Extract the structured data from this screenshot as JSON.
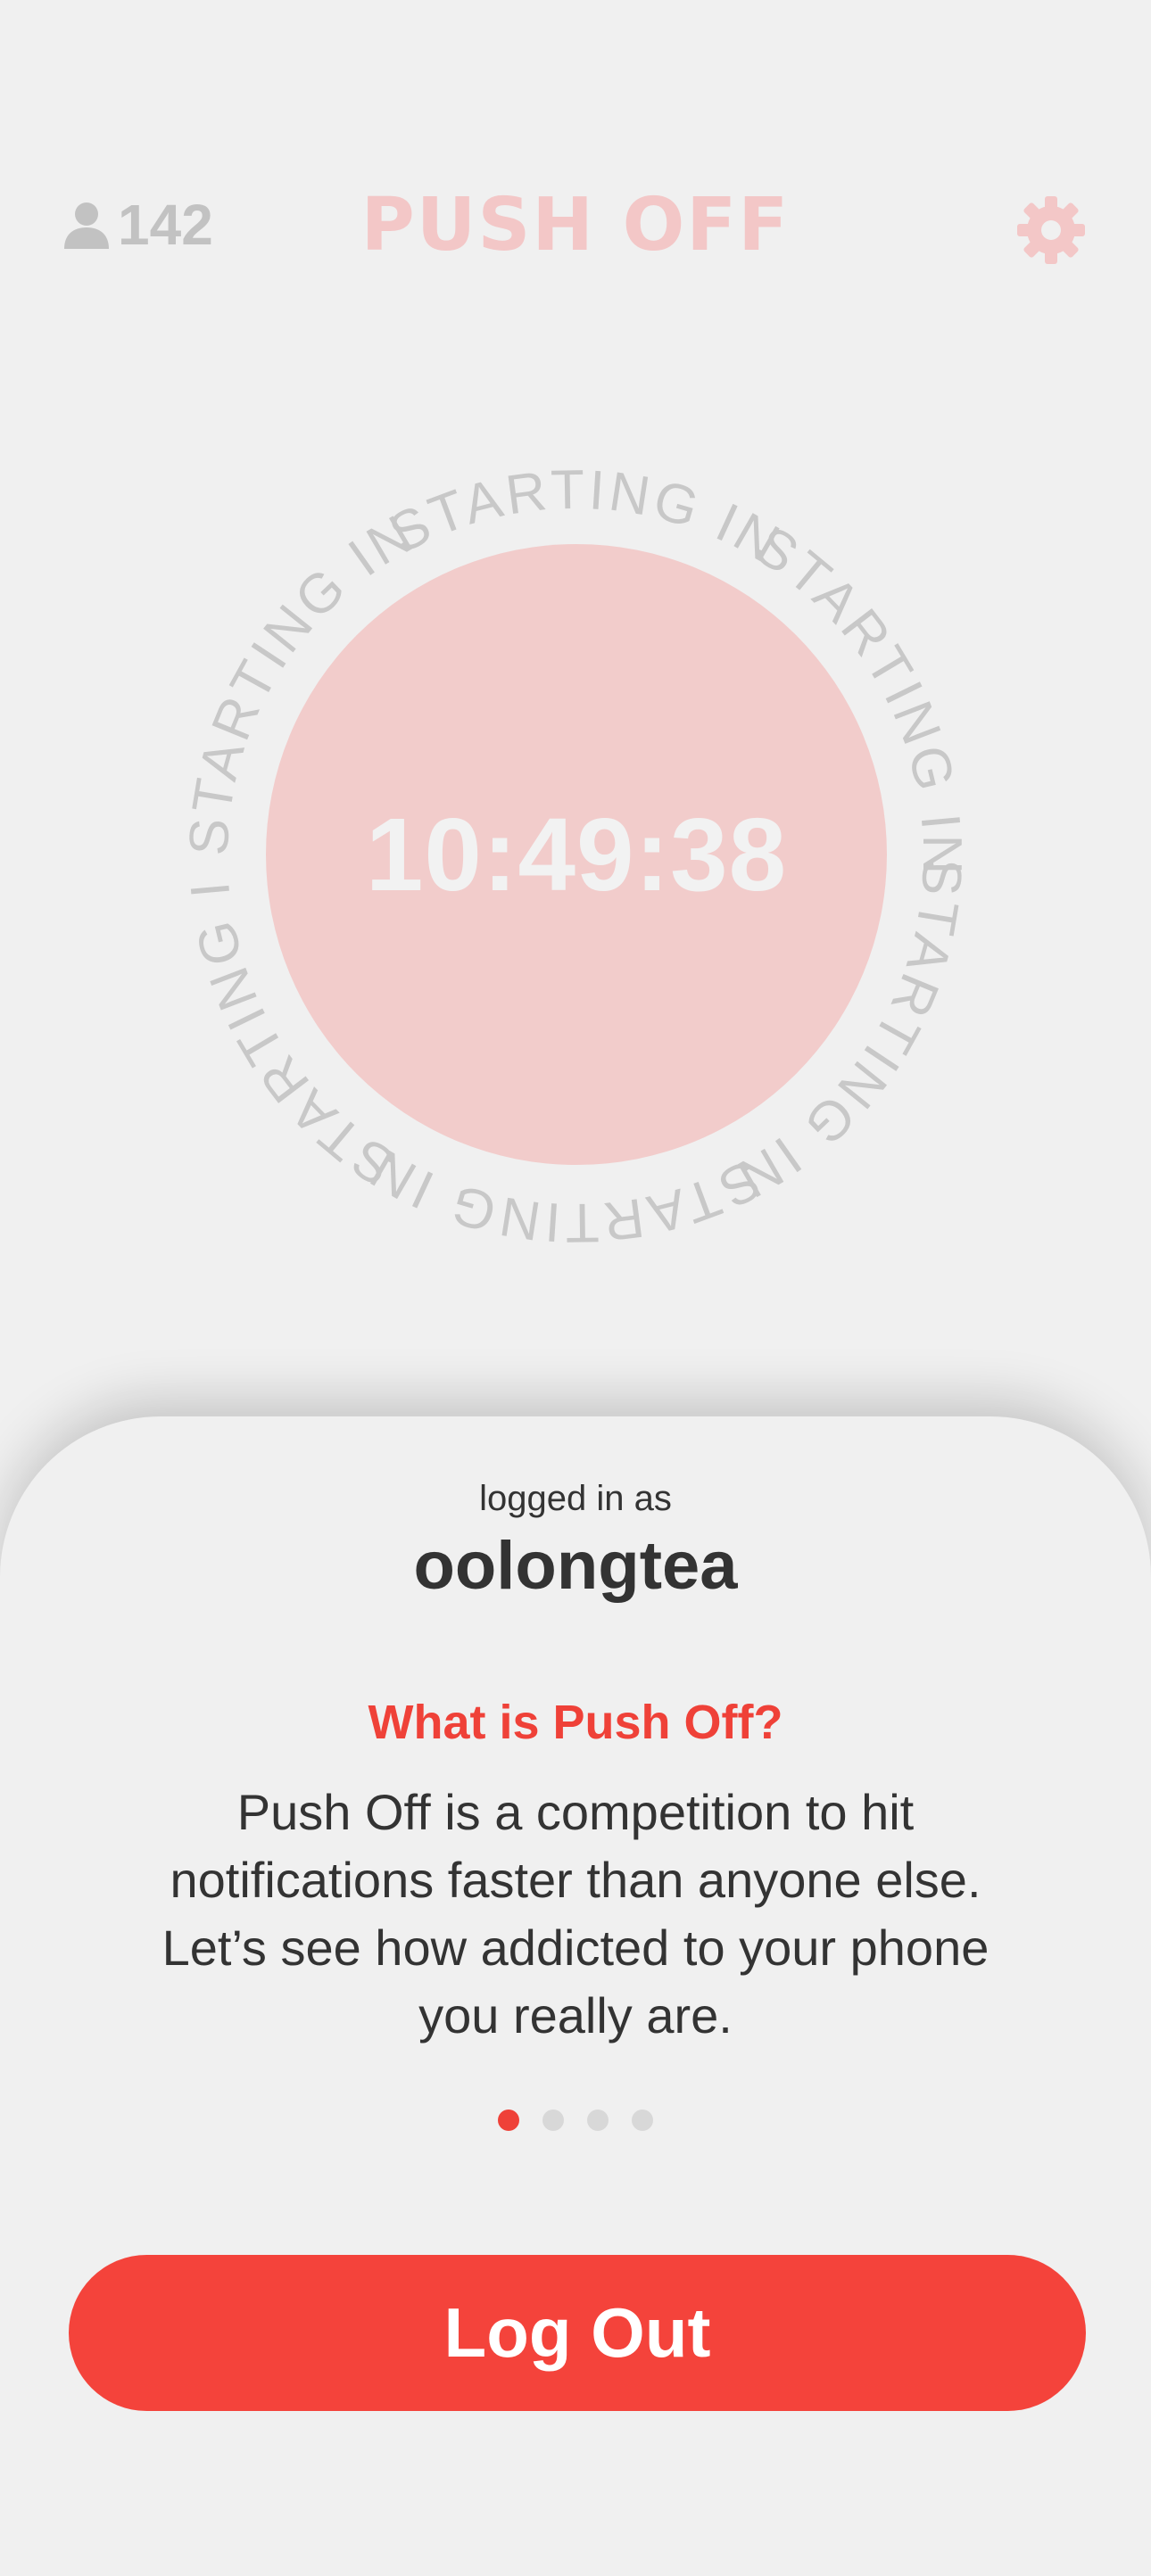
{
  "header": {
    "user_count": "142",
    "title": "PUSH OFF"
  },
  "timer": {
    "ring_text": "STARTING IN",
    "countdown": "10:49:38"
  },
  "sheet": {
    "logged_in_label": "logged in as",
    "username": "oolongtea",
    "info_title": "What is Push Off?",
    "info_body": "Push Off is a competition to hit notifications faster than anyone else. Let’s see how addicted to your phone you really are.",
    "page_indicator": {
      "total": 4,
      "active": 1
    },
    "logout_label": "Log Out"
  },
  "colors": {
    "accent": "#f4433b",
    "title_pink": "#f3c7c7",
    "circle_pink": "#f2cccb",
    "muted_gray": "#c2c2c2",
    "background": "#f0f0f0"
  },
  "icons": [
    "person-icon",
    "gear-icon"
  ]
}
